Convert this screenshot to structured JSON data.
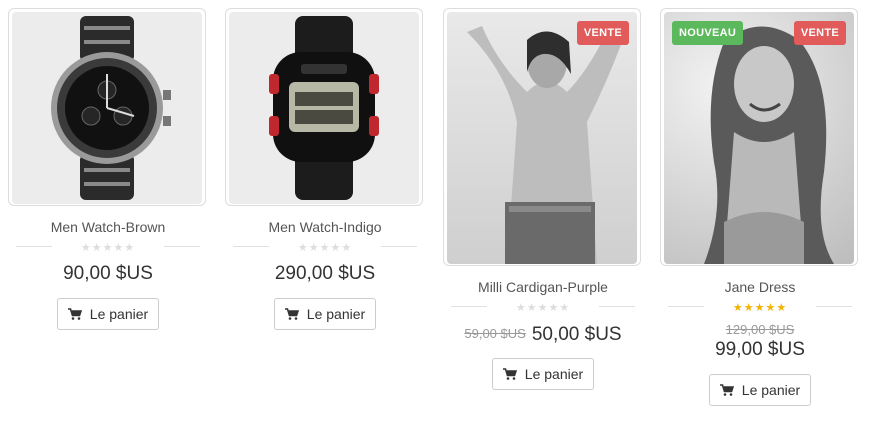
{
  "products": [
    {
      "name": "Men Watch-Brown",
      "image": "wristwatch-chronograph-image",
      "rating": 0,
      "price": "90,00 $US",
      "old_price": "",
      "button": "Le panier",
      "badges": []
    },
    {
      "name": "Men Watch-Indigo",
      "image": "digital-sport-watch-image",
      "rating": 0,
      "price": "290,00 $US",
      "old_price": "",
      "button": "Le panier",
      "badges": []
    },
    {
      "name": "Milli Cardigan-Purple",
      "image": "model-photo-image",
      "rating": 0,
      "price": "50,00 $US",
      "old_price": "59,00 $US",
      "button": "Le panier",
      "badges": [
        "VENTE"
      ]
    },
    {
      "name": "Jane Dress",
      "image": "model-photo-image",
      "rating": 5,
      "price": "99,00 $US",
      "old_price": "129,00 $US",
      "button": "Le panier",
      "badges": [
        "NOUVEAU",
        "VENTE"
      ]
    }
  ],
  "colors": {
    "sale_badge": "#e15b5b",
    "new_badge": "#5cb85c",
    "star_on": "#f0b400",
    "star_off": "#dddddd"
  }
}
